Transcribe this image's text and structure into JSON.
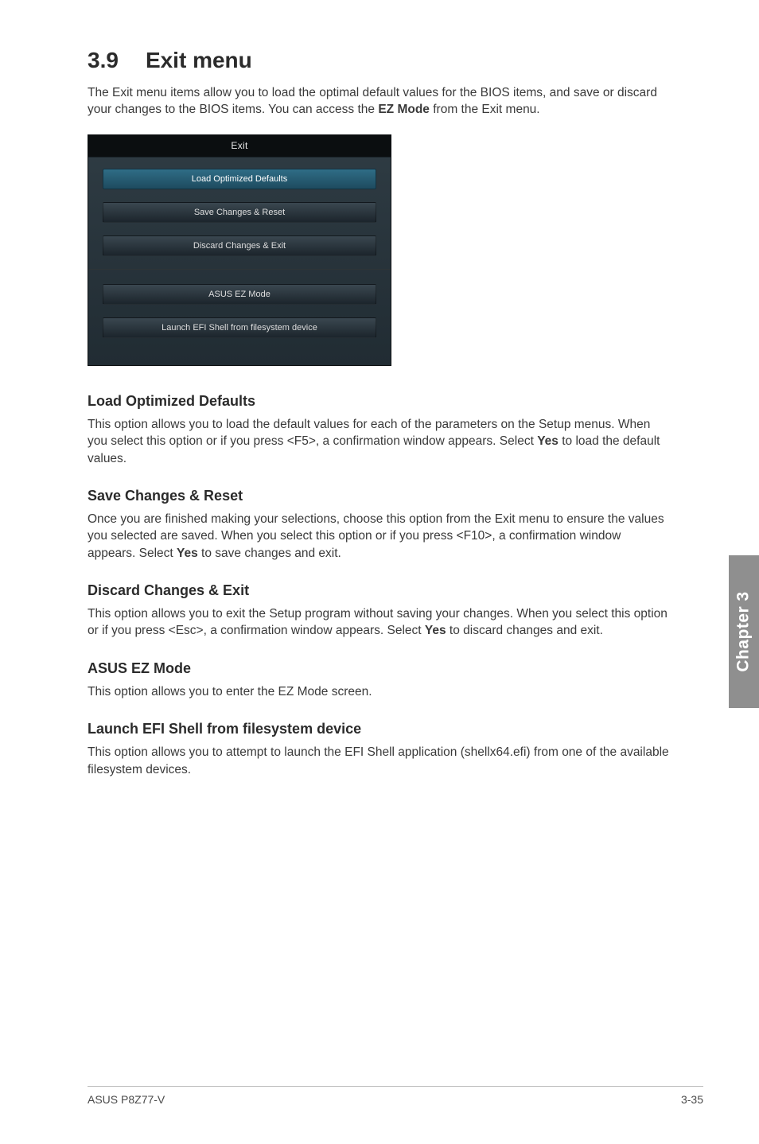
{
  "title": {
    "num": "3.9",
    "text": "Exit menu"
  },
  "intro": {
    "part1": "The Exit menu items allow you to load the optimal default values for the BIOS items, and save or discard your changes to the BIOS items. You can access the ",
    "bold": "EZ Mode",
    "part2": " from the Exit menu."
  },
  "bios": {
    "tab": "Exit",
    "btn_load": "Load Optimized Defaults",
    "btn_save": "Save Changes & Reset",
    "btn_discard": "Discard Changes & Exit",
    "btn_ezmode": "ASUS EZ Mode",
    "btn_efi": "Launch EFI Shell from filesystem device"
  },
  "sections": {
    "load": {
      "head": "Load Optimized Defaults",
      "p1": "This option allows you to load the default values for each of the parameters on the Setup menus. When you select this option or if you press <F5>, a confirmation window appears. Select ",
      "bold": "Yes",
      "p2": " to load the default values."
    },
    "save": {
      "head": "Save Changes & Reset",
      "p1": "Once you are finished making your selections, choose this option from the Exit menu to ensure the values you selected are saved. When you select this option or if you press <F10>, a confirmation window appears. Select ",
      "bold": "Yes",
      "p2": " to save changes and exit."
    },
    "discard": {
      "head": "Discard Changes & Exit",
      "p1": "This option allows you to exit the Setup program without saving your changes. When you select this option or if you press <Esc>, a confirmation window appears. Select ",
      "bold": "Yes",
      "p2": " to discard changes and exit."
    },
    "ezmode": {
      "head": "ASUS EZ Mode",
      "p": "This option allows you to enter the EZ Mode screen."
    },
    "efi": {
      "head": "Launch EFI Shell from filesystem device",
      "p": "This option allows you to attempt to launch the EFI Shell application (shellx64.efi) from one of the available filesystem devices."
    }
  },
  "side_tab": "Chapter 3",
  "footer": {
    "left": "ASUS P8Z77-V",
    "right": "3-35"
  }
}
